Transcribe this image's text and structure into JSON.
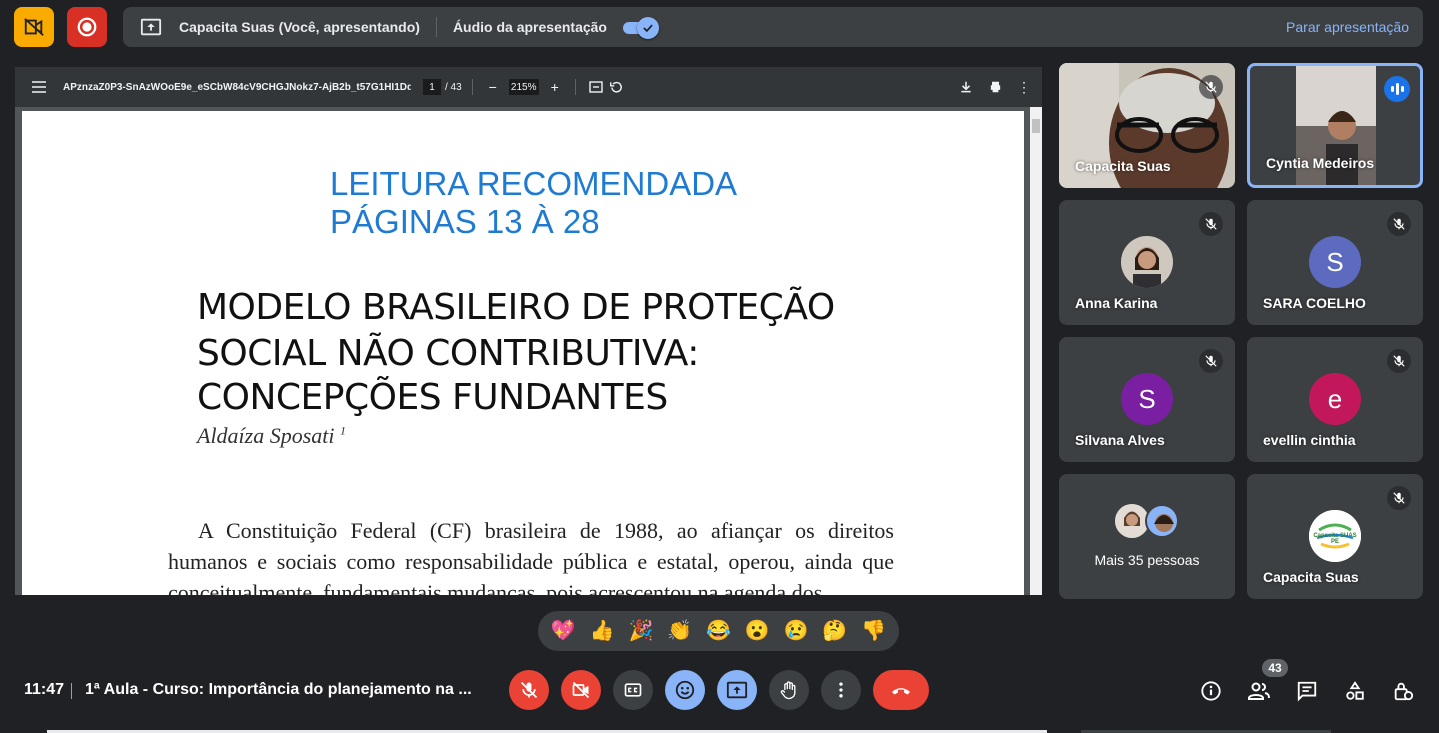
{
  "top_bar": {
    "presenter_title": "Capacita Suas (Você, apresentando)",
    "audio_label": "Áudio da apresentação",
    "audio_enabled": true,
    "stop_presenting": "Parar apresentação"
  },
  "pdf": {
    "file_name": "APznzaZ0P3-SnAzWOoE9e_eSCbW84cV9CHGJNokz7-AjB2b_t57G1HI1Ddjq...",
    "current_page": "1",
    "total_pages": "/ 43",
    "zoom": "215%",
    "page": {
      "recommend_line1": "LEITURA RECOMENDADA",
      "recommend_line2": "PÁGINAS 13 À 28",
      "title_line1": "MODELO BRASILEIRO DE PROTEÇÃO",
      "title_line2": "SOCIAL NÃO CONTRIBUTIVA:",
      "title_line3": "CONCEPÇÕES FUNDANTES",
      "author": "Aldaíza Sposati",
      "author_note": "1",
      "body": "A Constituição Federal (CF) brasileira de 1988, ao afiançar os direitos humanos e sociais como responsabilidade pública e estatal, operou, ainda que conceitualmente, fundamentais mudanças, pois acrescentou na agenda dos"
    }
  },
  "participants": [
    {
      "name": "Capacita Suas",
      "muted": true
    },
    {
      "name": "Cyntia Medeiros",
      "speaking": true
    },
    {
      "name": "Anna Karina",
      "muted": true
    },
    {
      "name": "SARA COELHO",
      "initial": "S",
      "color": "#5c6bc0",
      "muted": true
    },
    {
      "name": "Silvana Alves",
      "initial": "S",
      "color": "#7b1fa2",
      "muted": true
    },
    {
      "name": "evellin cinthia",
      "initial": "e",
      "color": "#c2185b",
      "muted": true
    },
    {
      "name": "Mais 35 pessoas"
    },
    {
      "name": "Capacita Suas",
      "logo_text": "Capacita SUAS PE",
      "muted": true
    }
  ],
  "reactions": [
    "💖",
    "👍",
    "🎉",
    "👏",
    "😂",
    "😮",
    "😢",
    "🤔",
    "👎"
  ],
  "bottom_bar": {
    "time": "11:47",
    "meeting_title": "1ª Aula - Curso: Importância do planejamento na ...",
    "people_count": "43"
  },
  "colors": {
    "background": "#202124",
    "accent": "#8ab4f8",
    "danger": "#ea4335",
    "warning": "#f9ab00"
  }
}
